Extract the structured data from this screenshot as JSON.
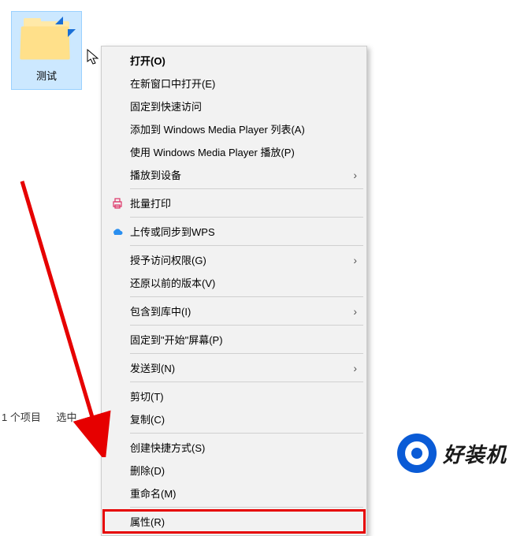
{
  "folder": {
    "label": "测试"
  },
  "menu": {
    "items": [
      {
        "label": "打开(O)",
        "bold": true
      },
      {
        "label": "在新窗口中打开(E)"
      },
      {
        "label": "固定到快速访问"
      },
      {
        "label": "添加到 Windows Media Player 列表(A)"
      },
      {
        "label": "使用 Windows Media Player 播放(P)"
      },
      {
        "label": "播放到设备",
        "submenu": true
      },
      {
        "sep": true
      },
      {
        "label": "批量打印",
        "icon": "printer"
      },
      {
        "sep": true
      },
      {
        "label": "上传或同步到WPS",
        "icon": "cloud"
      },
      {
        "sep": true
      },
      {
        "label": "授予访问权限(G)",
        "submenu": true
      },
      {
        "label": "还原以前的版本(V)"
      },
      {
        "sep": true
      },
      {
        "label": "包含到库中(I)",
        "submenu": true
      },
      {
        "sep": true
      },
      {
        "label": "固定到\"开始\"屏幕(P)"
      },
      {
        "sep": true
      },
      {
        "label": "发送到(N)",
        "submenu": true
      },
      {
        "sep": true
      },
      {
        "label": "剪切(T)"
      },
      {
        "label": "复制(C)"
      },
      {
        "sep": true
      },
      {
        "label": "创建快捷方式(S)"
      },
      {
        "label": "删除(D)"
      },
      {
        "label": "重命名(M)"
      },
      {
        "sep": true
      },
      {
        "label": "属性(R)",
        "highlighted": true
      }
    ]
  },
  "status": {
    "count": "1 个项目",
    "selection": "选中"
  },
  "watermark": {
    "text": "好装机"
  }
}
